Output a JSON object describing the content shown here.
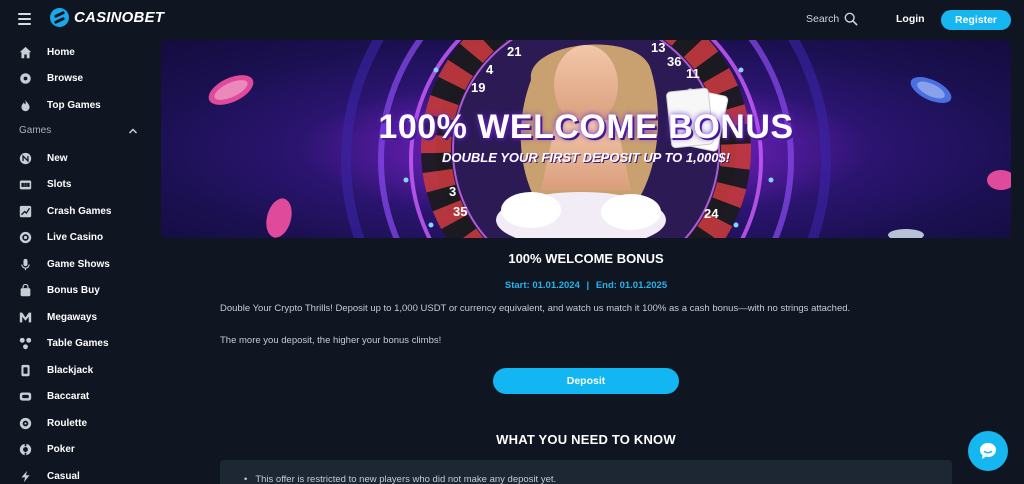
{
  "header": {
    "logo_text": "CASINOBET",
    "search_label": "Search",
    "login_label": "Login",
    "register_label": "Register"
  },
  "sidebar": {
    "top_items": [
      {
        "label": "Home",
        "icon": "home-icon"
      },
      {
        "label": "Browse",
        "icon": "browse-icon"
      },
      {
        "label": "Top Games",
        "icon": "flame-icon"
      }
    ],
    "section_label": "Games",
    "game_items": [
      {
        "label": "New",
        "icon": "new-icon"
      },
      {
        "label": "Slots",
        "icon": "slots-icon"
      },
      {
        "label": "Crash Games",
        "icon": "crash-icon"
      },
      {
        "label": "Live Casino",
        "icon": "live-casino-icon"
      },
      {
        "label": "Game Shows",
        "icon": "microphone-icon"
      },
      {
        "label": "Bonus Buy",
        "icon": "bonus-bag-icon"
      },
      {
        "label": "Megaways",
        "icon": "megaways-icon"
      },
      {
        "label": "Table Games",
        "icon": "table-games-icon"
      },
      {
        "label": "Blackjack",
        "icon": "blackjack-icon"
      },
      {
        "label": "Baccarat",
        "icon": "baccarat-icon"
      },
      {
        "label": "Roulette",
        "icon": "roulette-icon"
      },
      {
        "label": "Poker",
        "icon": "poker-chip-icon"
      },
      {
        "label": "Casual",
        "icon": "lightning-icon"
      }
    ]
  },
  "banner": {
    "title": "100% WELCOME BONUS",
    "subtitle": "DOUBLE YOUR FIRST DEPOSIT UP TO 1,000$!",
    "roulette_numbers": [
      "13",
      "36",
      "11",
      "4",
      "21",
      "19",
      "3",
      "35",
      "24"
    ]
  },
  "promo": {
    "title": "100% WELCOME BONUS",
    "start_label": "Start:",
    "start_date": "01.01.2024",
    "separator": "|",
    "end_label": "End:",
    "end_date": "01.01.2025",
    "description_1": "Double Your Crypto Thrills! Deposit up to 1,000 USDT or currency equivalent, and watch us match it 100% as a cash bonus—with no strings attached.",
    "description_2": "The more you deposit, the higher your bonus climbs!",
    "deposit_label": "Deposit",
    "need_to_know_title": "WHAT YOU NEED TO KNOW",
    "info_items": [
      "This offer is restricted to new players who did not make any deposit yet."
    ]
  },
  "colors": {
    "accent": "#16b6f1",
    "background": "#0f1621",
    "date_text": "#25b3ee"
  }
}
